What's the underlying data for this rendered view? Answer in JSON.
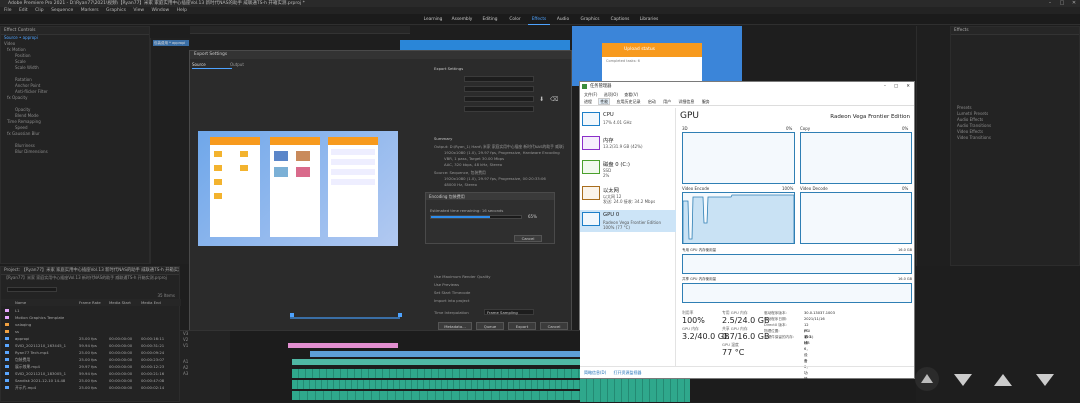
{
  "titlebar": {
    "title": "Adobe Premiere Pro 2021 - D:\\Ryan77\\2021\\视频\\【Ryan77】米家 家庭实用中心插座Vol.13 新时代NAS的助手 威联通TS-h 开箱实测.prproj *",
    "controls": [
      "–",
      "□",
      "✕"
    ]
  },
  "menubar": {
    "items": [
      "File",
      "Edit",
      "Clip",
      "Sequence",
      "Markers",
      "Graphics",
      "View",
      "Window",
      "Help"
    ]
  },
  "workspaces": {
    "tabs": [
      "Learning",
      "Assembly",
      "Editing",
      "Color",
      "Effects",
      "Audio",
      "Graphics",
      "Captions",
      "Libraries"
    ],
    "active": "Effects"
  },
  "left_panel": {
    "header": "Effect Controls",
    "source": "Source • appropi",
    "sequence": "包装费用 * appropi",
    "section": "Video",
    "rows": [
      "fx  Motion",
      "Position",
      "Scale",
      "Scale Width",
      "",
      "Rotation",
      "Anchor Point",
      "Anti-flicker Filter",
      "fx  Opacity",
      "",
      "Opacity",
      "Blend Mode",
      "Time Remapping",
      "Speed",
      "fx  Gaussian Blur",
      "",
      "Blurriness",
      "Blur Dimensions"
    ]
  },
  "project_panel": {
    "header": "Project: 【Ryan77】米家 家庭实用中心插座Vol.13 新时代NAS的助手 威联通TS-h 开箱实测.prproj",
    "path": "【Ryan77】米家 家庭实用中心插座Vol.13 新时代NAS的助手 威联通TS-h 开箱实测.prproj",
    "count": "35 Items",
    "columns": [
      "Name",
      "Frame Rate",
      "Media Start",
      "Media End"
    ],
    "rows": [
      {
        "name": "L1",
        "rate": "",
        "start": "",
        "end": "",
        "color": "#e6a7ff"
      },
      {
        "name": "Motion Graphics Template",
        "rate": "",
        "start": "",
        "end": "",
        "color": "#e6a7ff"
      },
      {
        "name": "valaqing",
        "rate": "",
        "start": "",
        "end": "",
        "color": "#f0a040"
      },
      {
        "name": "ss",
        "rate": "",
        "start": "",
        "end": "",
        "color": "#f0a040"
      },
      {
        "name": "appropi",
        "rate": "25.00 fps",
        "start": "00:00:00:00",
        "end": "00:00:16:11",
        "color": "#5aa6ff"
      },
      {
        "name": "SVID_20211210_163445_1",
        "rate": "59.94 fps",
        "start": "00:00:00:00",
        "end": "00:00:31:21",
        "color": "#5aa6ff"
      },
      {
        "name": "Ryan77 Tech.mp4",
        "rate": "25.00 fps",
        "start": "00:00:00:00",
        "end": "00:00:09:24",
        "color": "#5aa6ff"
      },
      {
        "name": "包装费用",
        "rate": "25.00 fps",
        "start": "00:00:00:00",
        "end": "00:00:23:07",
        "color": "#5aa6ff"
      },
      {
        "name": "展示效果.mp4",
        "rate": "29.97 fps",
        "start": "00:00:00:00",
        "end": "00:00:12:23",
        "color": "#5aa6ff"
      },
      {
        "name": "SVID_20211210_183005_1",
        "rate": "59.94 fps",
        "start": "00:00:00:00",
        "end": "00:00:21:16",
        "color": "#5aa6ff"
      },
      {
        "name": "Sandisk 2021-12-10 14-48",
        "rate": "25.00 fps",
        "start": "00:00:00:00",
        "end": "00:00:47:08",
        "color": "#5aa6ff"
      },
      {
        "name": "开示片.mp4",
        "rate": "25.00 fps",
        "start": "00:00:00:00",
        "end": "00:00:02:14",
        "color": "#5aa6ff"
      }
    ]
  },
  "export_dialog": {
    "title": "Export Settings",
    "source_tab": "Source",
    "output_tab": "Output",
    "export_settings_label": "Export Settings",
    "summary_label": "Summary",
    "output_summary": "Output: D:\\Ryan_1\\ Hard\\ 米家 家庭实用中心插座 新时代NAS的助手 威联通TS-h开箱实测.mp4",
    "output_detail": "1920x1080 (1.0), 29.97 fps, Progressive, Hardware Encoding",
    "output_detail2": "VBR, 1 pass, Target 30.00 Mbps",
    "output_detail3": "AAC, 320 kbps, 48 kHz, Stereo",
    "source_summary": "Source: Sequence, 包装费用",
    "source_detail": "1920x1080 (1.0), 29.97 fps, Progressive, 00:20:33:06",
    "source_detail2": "48000 Hz, Stereo",
    "use_max_render": "Use Maximum Render Quality",
    "use_previews": "Use Previews",
    "import_project": "Import into project",
    "set_start_timecode": "Set Start Timecode",
    "time_interpolation": "Time Interpolation",
    "frame_sampling": "Frame Sampling",
    "metadata_button": "Metadata...",
    "queue_button": "Queue",
    "export_button": "Export",
    "cancel_button": "Cancel"
  },
  "encoding_dialog": {
    "title": "Encoding 包装费用",
    "status": "Estimated time remaining: 16 seconds",
    "percent": "65%",
    "progress": 0.65,
    "cancel": "Cancel"
  },
  "phone_app": {
    "title": "Upload status",
    "subtitle": "Completed tasks: 6"
  },
  "task_manager": {
    "title": "任务管理器",
    "controls": [
      "–",
      "□",
      "✕"
    ],
    "menu": [
      "文件(F)",
      "选项(O)",
      "查看(V)"
    ],
    "tabs": [
      "进程",
      "性能",
      "应用历史记录",
      "启动",
      "用户",
      "详细信息",
      "服务"
    ],
    "active_tab": "性能",
    "side": [
      {
        "name": "CPU",
        "detail": "17%  4.01 GHz",
        "color": "#1c7ec8"
      },
      {
        "name": "内存",
        "detail": "13.2/31.9 GB (42%)",
        "color": "#8b2fc9"
      },
      {
        "name": "磁盘 0 (C:)",
        "detail": "SSD",
        "detail2": "2%",
        "color": "#4aa02c"
      },
      {
        "name": "以太网",
        "detail": "以太网 12",
        "detail2": "发送: 24.0  接收: 34.2 Mbps",
        "color": "#a86d1d"
      },
      {
        "name": "GPU 0",
        "detail": "Radeon Vega Frontier Edition",
        "detail2": "100% (77 °C)",
        "color": "#1c7ec8"
      }
    ],
    "gpu_heading": "GPU",
    "gpu_name": "Radeon Vega Frontier Edition",
    "graphs": [
      {
        "label": "3D",
        "pct": "0%"
      },
      {
        "label": "Copy",
        "pct": "0%"
      },
      {
        "label": "Video Encode",
        "pct": "100%"
      },
      {
        "label": "Video Decode",
        "pct": "0%"
      }
    ],
    "dedicated_label": "专用 GPU 内存使用量",
    "dedicated_max": "16.0 GB",
    "shared_label": "共享 GPU 内存使用量",
    "shared_max": "16.0 GB",
    "stats": {
      "util_k": "利用率",
      "util_v": "100%",
      "ded_k": "专用 GPU 内存",
      "ded_v": "2.5/24.0 GB",
      "gpu_mem_k": "GPU 内存",
      "gpu_mem_v": "3.2/40.0 GB",
      "shared_k": "共享 GPU 内存",
      "shared_v": "0.7/16.0 GB",
      "temp_k": "GPU 温度",
      "temp_v": "77 °C"
    },
    "info": [
      {
        "k": "驱动程序版本:",
        "v": "30.0.13037.1003"
      },
      {
        "k": "驱动程序日期:",
        "v": "2021/11/16"
      },
      {
        "k": "DirectX 版本:",
        "v": "12 (FL 12.1)"
      },
      {
        "k": "物理位置:",
        "v": "PCI 总线 6，设备 0，功能 0"
      },
      {
        "k": "为硬件保留的内存:",
        "v": "393 MB"
      }
    ],
    "footer_less": "简略信息(D)",
    "footer_open": "打开资源监视器"
  },
  "right_panel": {
    "header": "Effects",
    "sections": [
      "Presets",
      "Lumetri Presets",
      "Audio Effects",
      "Audio Transitions",
      "Video Effects",
      "Video Transitions"
    ]
  },
  "timeline": {
    "tracks": [
      "V3",
      "V2",
      "V1",
      "A1",
      "A2",
      "A3"
    ]
  },
  "taskbar": {
    "icons": [
      "▲",
      "▼",
      "▲",
      "▼"
    ]
  }
}
